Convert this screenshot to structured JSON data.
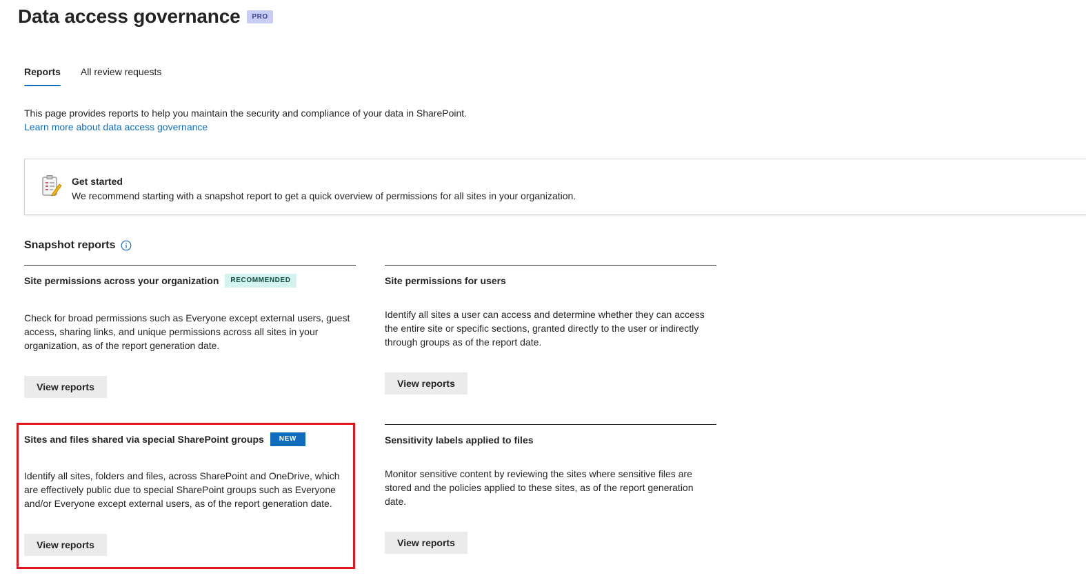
{
  "header": {
    "title": "Data access governance",
    "badge": "PRO"
  },
  "tabs": [
    {
      "label": "Reports",
      "active": true
    },
    {
      "label": "All review requests",
      "active": false
    }
  ],
  "intro": {
    "text": "This page provides reports to help you maintain the security and compliance of your data in SharePoint.",
    "link": "Learn more about data access governance"
  },
  "get_started": {
    "title": "Get started",
    "description": "We recommend starting with a snapshot report to get a quick overview of permissions for all sites in your organization."
  },
  "section": {
    "title": "Snapshot reports"
  },
  "cards": [
    {
      "title": "Site permissions across your organization",
      "badge": "RECOMMENDED",
      "description": "Check for broad permissions such as Everyone except external users, guest access, sharing links, and unique permissions across all sites in your organization, as of the report generation date.",
      "button": "View reports"
    },
    {
      "title": "Site permissions for users",
      "description": "Identify all sites a user can access and determine whether they can access the entire site or specific sections, granted directly to the user or indirectly through groups as of the report date.",
      "button": "View reports"
    },
    {
      "title": "Sites and files shared via special SharePoint groups",
      "badge": "NEW",
      "description": "Identify all sites, folders and files, across SharePoint and OneDrive, which are effectively public due to special SharePoint groups such as Everyone and/or Everyone except external users, as of the report generation date.",
      "button": "View reports"
    },
    {
      "title": "Sensitivity labels applied to files",
      "description": "Monitor sensitive content by reviewing the sites where sensitive files are stored and the policies applied to these sites, as of the report generation date.",
      "button": "View reports"
    }
  ],
  "colors": {
    "accent": "#0f6cbd",
    "highlight": "#e0161c",
    "recommended_bg": "#d4f3ee",
    "pro_bg": "#c7cdf5"
  }
}
